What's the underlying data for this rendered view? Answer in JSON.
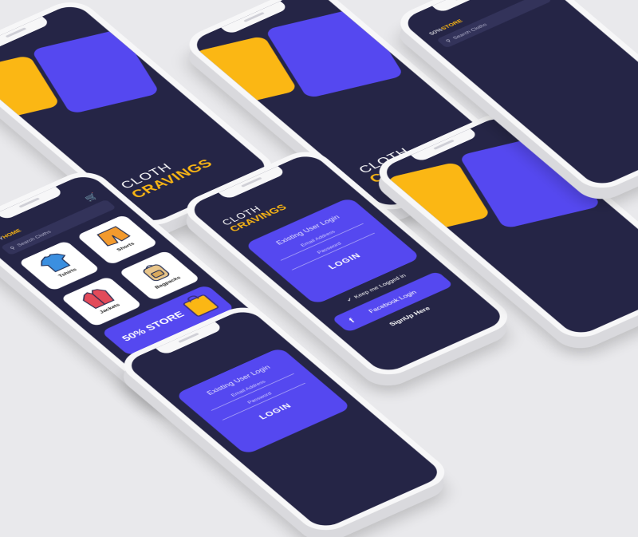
{
  "brand": {
    "line1": "CLOTH",
    "line2": "CRAVINGS"
  },
  "colors": {
    "navy": "#252546",
    "yellow": "#fbb714",
    "violet": "#5548f0"
  },
  "login": {
    "title": "Existing User Login",
    "email_placeholder": "Email Address",
    "password_placeholder": "Password",
    "login_label": "LOGIN",
    "keep_logged_in": "Keep me Logged in",
    "facebook_label": "Facebook Login",
    "facebook_icon": "f",
    "signup_label": "SignUp Here"
  },
  "home": {
    "prefix": "MY",
    "title": "HOME",
    "search_placeholder": "Search Cloths",
    "categories": [
      {
        "label": "Tshirts",
        "icon": "tshirt-icon"
      },
      {
        "label": "Shorts",
        "icon": "shorts-icon"
      },
      {
        "label": "Jackets",
        "icon": "jacket-icon"
      },
      {
        "label": "Bagpacks",
        "icon": "backpack-icon"
      }
    ],
    "store_banner": "50% STORE"
  },
  "store_screen": {
    "prefix": "50%",
    "title": "STORE",
    "search_placeholder": "Search Cloths"
  }
}
